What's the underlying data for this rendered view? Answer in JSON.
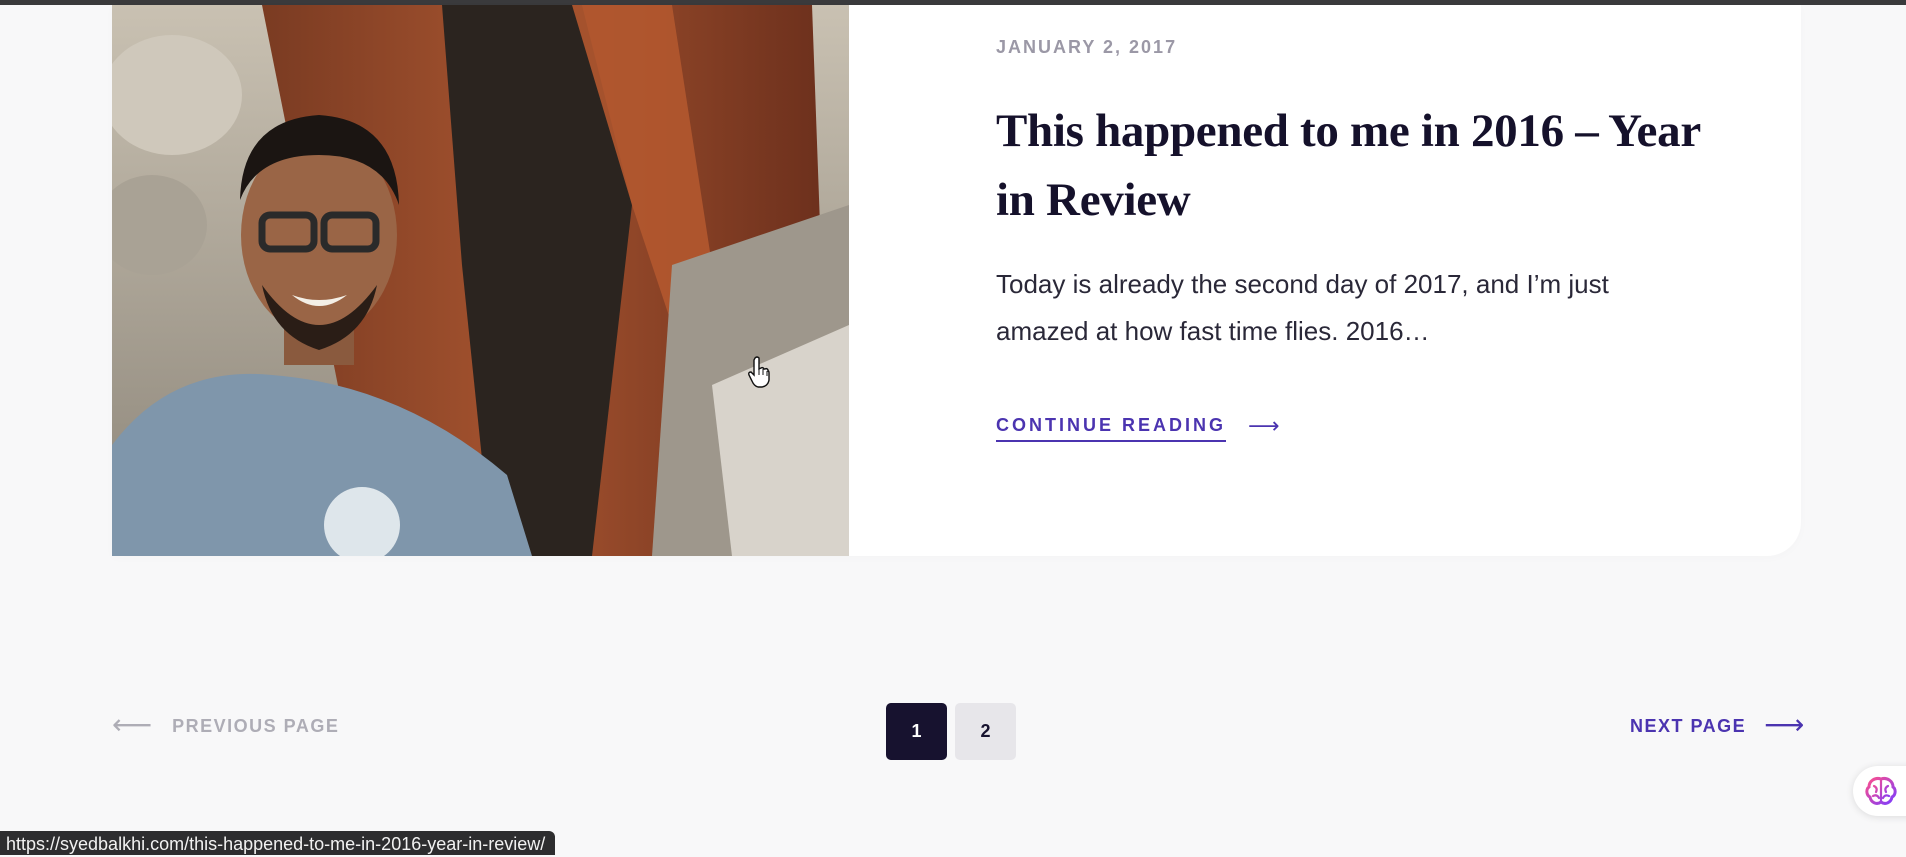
{
  "post": {
    "date": "JANUARY 2, 2017",
    "title": "This happened to me in 2016 – Year in Review",
    "excerpt": "Today is already the second day of 2017, and I’m just amazed at how fast time flies. 2016…",
    "continue_label": "CONTINUE READING",
    "continue_arrow": "⟶",
    "image_icon": "person-in-front-of-tree-photo"
  },
  "pagination": {
    "prev_label": "PREVIOUS PAGE",
    "prev_arrow": "⟵",
    "pages": [
      "1",
      "2"
    ],
    "current_page": "1",
    "next_label": "NEXT PAGE",
    "next_arrow": "⟶"
  },
  "status_bar": {
    "url": "https://syedbalkhi.com/this-happened-to-me-in-2016-year-in-review/"
  },
  "colors": {
    "accent": "#4b34b0",
    "title": "#15112b",
    "active_page": "#17122f",
    "background": "#f8f8f9"
  },
  "icons": {
    "assistant": "brain-icon",
    "cursor": "hand-pointer-icon"
  }
}
